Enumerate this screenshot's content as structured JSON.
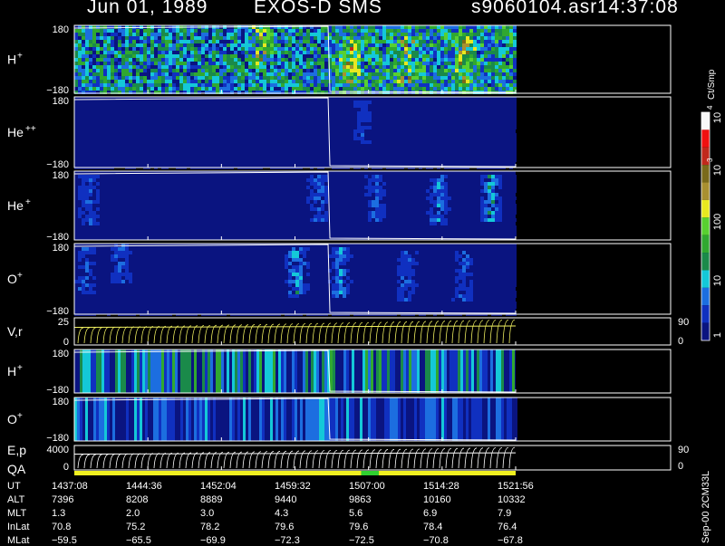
{
  "header": {
    "date": "Jun 01, 1989",
    "instrument": "EXOS-D SMS",
    "file": "s9060104.asr",
    "time": "14:37:08"
  },
  "colorbar": {
    "title": "Ct/Smp",
    "ticks": [
      "1",
      "10",
      "100",
      "10",
      "10"
    ],
    "exponents": [
      "",
      "",
      "",
      "3",
      "4"
    ],
    "colors": [
      "#0a1480",
      "#1030c0",
      "#1c6ee0",
      "#14c8d8",
      "#1a8a4a",
      "#30a830",
      "#58d030",
      "#e8e820",
      "#a89030",
      "#7a6a1a",
      "#c0281c",
      "#f01010",
      "#f8f8f8"
    ]
  },
  "table": {
    "labels": [
      "UT",
      "ALT",
      "MLT",
      "InLat",
      "MLat"
    ],
    "rows": [
      [
        "1437:08",
        "1444:36",
        "1452:04",
        "1459:32",
        "1507:00",
        "1514:28",
        "1521:56"
      ],
      [
        "7396",
        "8208",
        "8889",
        "9440",
        "9863",
        "10160",
        "10332"
      ],
      [
        "1.3",
        "2.0",
        "3.0",
        "4.3",
        "5.6",
        "6.9",
        "7.9"
      ],
      [
        "70.8",
        "75.2",
        "78.2",
        "79.6",
        "79.6",
        "78.4",
        "76.4"
      ],
      [
        "−59.5",
        "−65.5",
        "−69.9",
        "−72.3",
        "−72.5",
        "−70.8",
        "−67.8"
      ]
    ]
  },
  "footer_side": "Sep-00  2CM33L",
  "chart_data": {
    "type": "heatmap",
    "x_ticks": [
      "1437:08",
      "1444:36",
      "1452:04",
      "1459:32",
      "1507:00",
      "1514:28",
      "1521:56"
    ],
    "panels": [
      {
        "label": "H",
        "sup": "+",
        "ytop": "180",
        "ybot": "−180",
        "kind": "spec",
        "base": 0.38,
        "noise": 0.35,
        "spots": [
          [
            0.42,
            0.25,
            0.75
          ],
          [
            0.62,
            0.5,
            0.7
          ],
          [
            0.75,
            0.5,
            0.65
          ],
          [
            0.88,
            0.5,
            0.6
          ]
        ]
      },
      {
        "label": "He",
        "sup": "++",
        "ytop": "180",
        "ybot": "−180",
        "kind": "spec",
        "base": 0.06,
        "noise": 0.02,
        "spots": [
          [
            0.65,
            0.35,
            0.25
          ]
        ]
      },
      {
        "label": "He",
        "sup": "+",
        "ytop": "180",
        "ybot": "−180",
        "kind": "spec",
        "base": 0.07,
        "noise": 0.03,
        "spots": [
          [
            0.03,
            0.4,
            0.3
          ],
          [
            0.55,
            0.35,
            0.35
          ],
          [
            0.68,
            0.35,
            0.35
          ],
          [
            0.82,
            0.4,
            0.4
          ],
          [
            0.94,
            0.35,
            0.55
          ]
        ]
      },
      {
        "label": "O",
        "sup": "+",
        "ytop": "180",
        "ybot": "−180",
        "kind": "spec",
        "base": 0.07,
        "noise": 0.03,
        "spots": [
          [
            0.02,
            0.35,
            0.3
          ],
          [
            0.1,
            0.2,
            0.35
          ],
          [
            0.5,
            0.4,
            0.5
          ],
          [
            0.6,
            0.4,
            0.4
          ],
          [
            0.75,
            0.45,
            0.3
          ],
          [
            0.88,
            0.45,
            0.3
          ]
        ]
      },
      {
        "label": "V,r",
        "sup": "",
        "ytop": "25",
        "ybot": "0",
        "kind": "line",
        "right_top": "90",
        "right_bot": "0"
      },
      {
        "label": "H",
        "sup": "+",
        "ytop": "180",
        "ybot": "−180",
        "kind": "stripe",
        "base": 0.33,
        "noise": 0.35,
        "spots": [
          [
            0.65,
            0.4,
            0.5
          ],
          [
            0.93,
            0.4,
            0.7
          ]
        ]
      },
      {
        "label": "O",
        "sup": "+",
        "ytop": "180",
        "ybot": "−180",
        "kind": "stripe",
        "base": 0.2,
        "noise": 0.22,
        "spots": [
          [
            0.65,
            0.4,
            0.35
          ]
        ]
      },
      {
        "label": "E,p",
        "sup": "",
        "ytop": "4000",
        "ybot": "0",
        "kind": "line",
        "right_top": "90",
        "right_bot": "0",
        "label2": "QA"
      }
    ],
    "qa_bar": [
      {
        "from": 0.0,
        "to": 0.65,
        "color": "#f0f020"
      },
      {
        "from": 0.65,
        "to": 0.69,
        "color": "#30d030"
      },
      {
        "from": 0.69,
        "to": 1.0,
        "color": "#f0f020"
      }
    ]
  }
}
